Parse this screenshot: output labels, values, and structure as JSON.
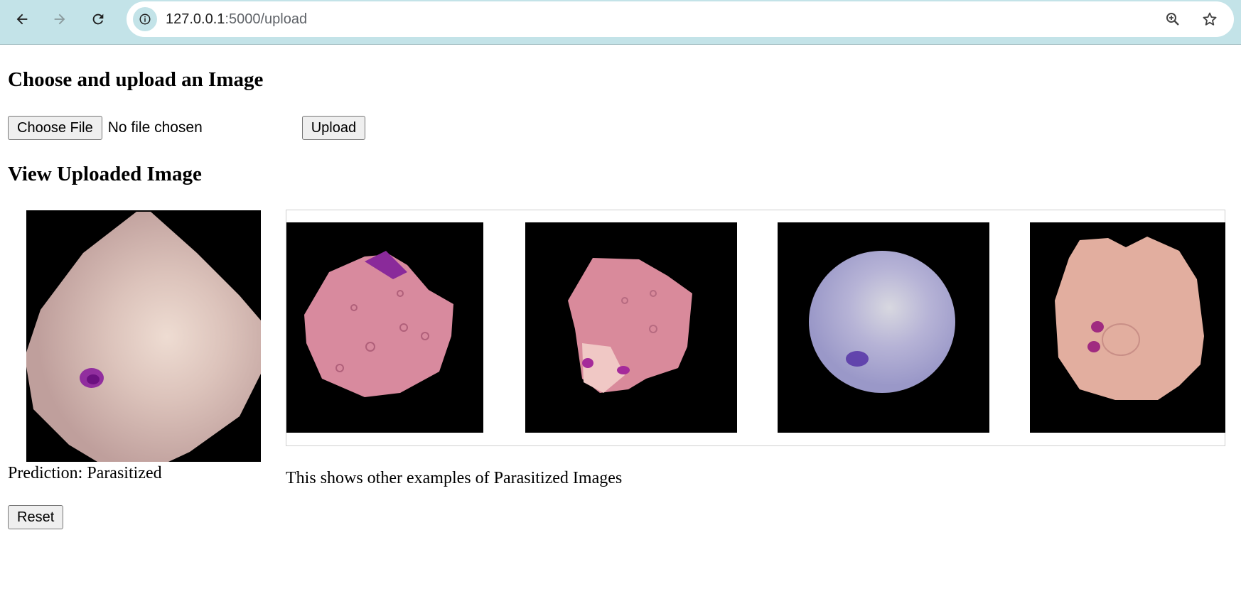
{
  "browser": {
    "url_host": "127.0.0.1",
    "url_path": ":5000/upload",
    "icons": [
      "back-arrow-icon",
      "forward-arrow-icon",
      "reload-icon",
      "site-info-icon",
      "zoom-icon",
      "bookmark-star-icon"
    ]
  },
  "upload_section": {
    "heading": "Choose and upload an Image",
    "choose_file_label": "Choose File",
    "file_status": "No file chosen",
    "upload_label": "Upload"
  },
  "view_section": {
    "heading": "View Uploaded Image",
    "prediction_text": "Prediction: Parasitized",
    "reset_label": "Reset",
    "examples_caption": "This shows other examples of Parasitized Images"
  },
  "colors": {
    "toolbar_bg": "#c3e3e8",
    "cell_pink": "#d9899c",
    "cell_purple": "#a8a8d0",
    "cell_peach": "#e4b0a4",
    "cell_mauve": "#c9a9a6",
    "parasite": "#8a1f9c"
  }
}
